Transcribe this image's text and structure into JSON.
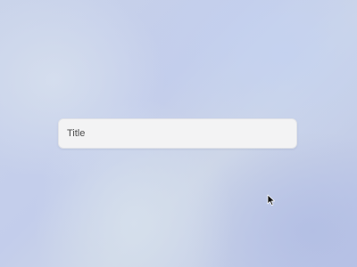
{
  "title_field": {
    "placeholder": "Title",
    "value": ""
  },
  "icons": {
    "cursor": "mouse-pointer-icon"
  },
  "colors": {
    "field_background": "#f3f3f4",
    "desktop_tint": "#c3cdeb"
  }
}
